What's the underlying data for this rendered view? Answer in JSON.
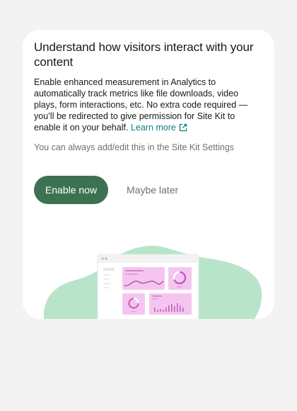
{
  "card": {
    "title": "Understand how visitors interact with your content",
    "description": "Enable enhanced measurement in Analytics to automatically track metrics like file downloads, video plays, form interactions, etc. No extra code required — you’ll be redirected to give permission for Site Kit to enable it on your behalf.",
    "learn_more_label": "Learn more",
    "note": "You can always add/edit this in the Site Kit Settings",
    "primary_button_label": "Enable now",
    "secondary_button_label": "Maybe later"
  },
  "colors": {
    "page_background": "#f3f3f3",
    "card_background": "#ffffff",
    "primary_button": "#3c7251",
    "link": "#108080",
    "blob": "#b8e5ca",
    "chart_pink": "#f4c6ef",
    "chart_line": "#b13eaa"
  },
  "icons": {
    "external_link": "external-link-icon"
  }
}
